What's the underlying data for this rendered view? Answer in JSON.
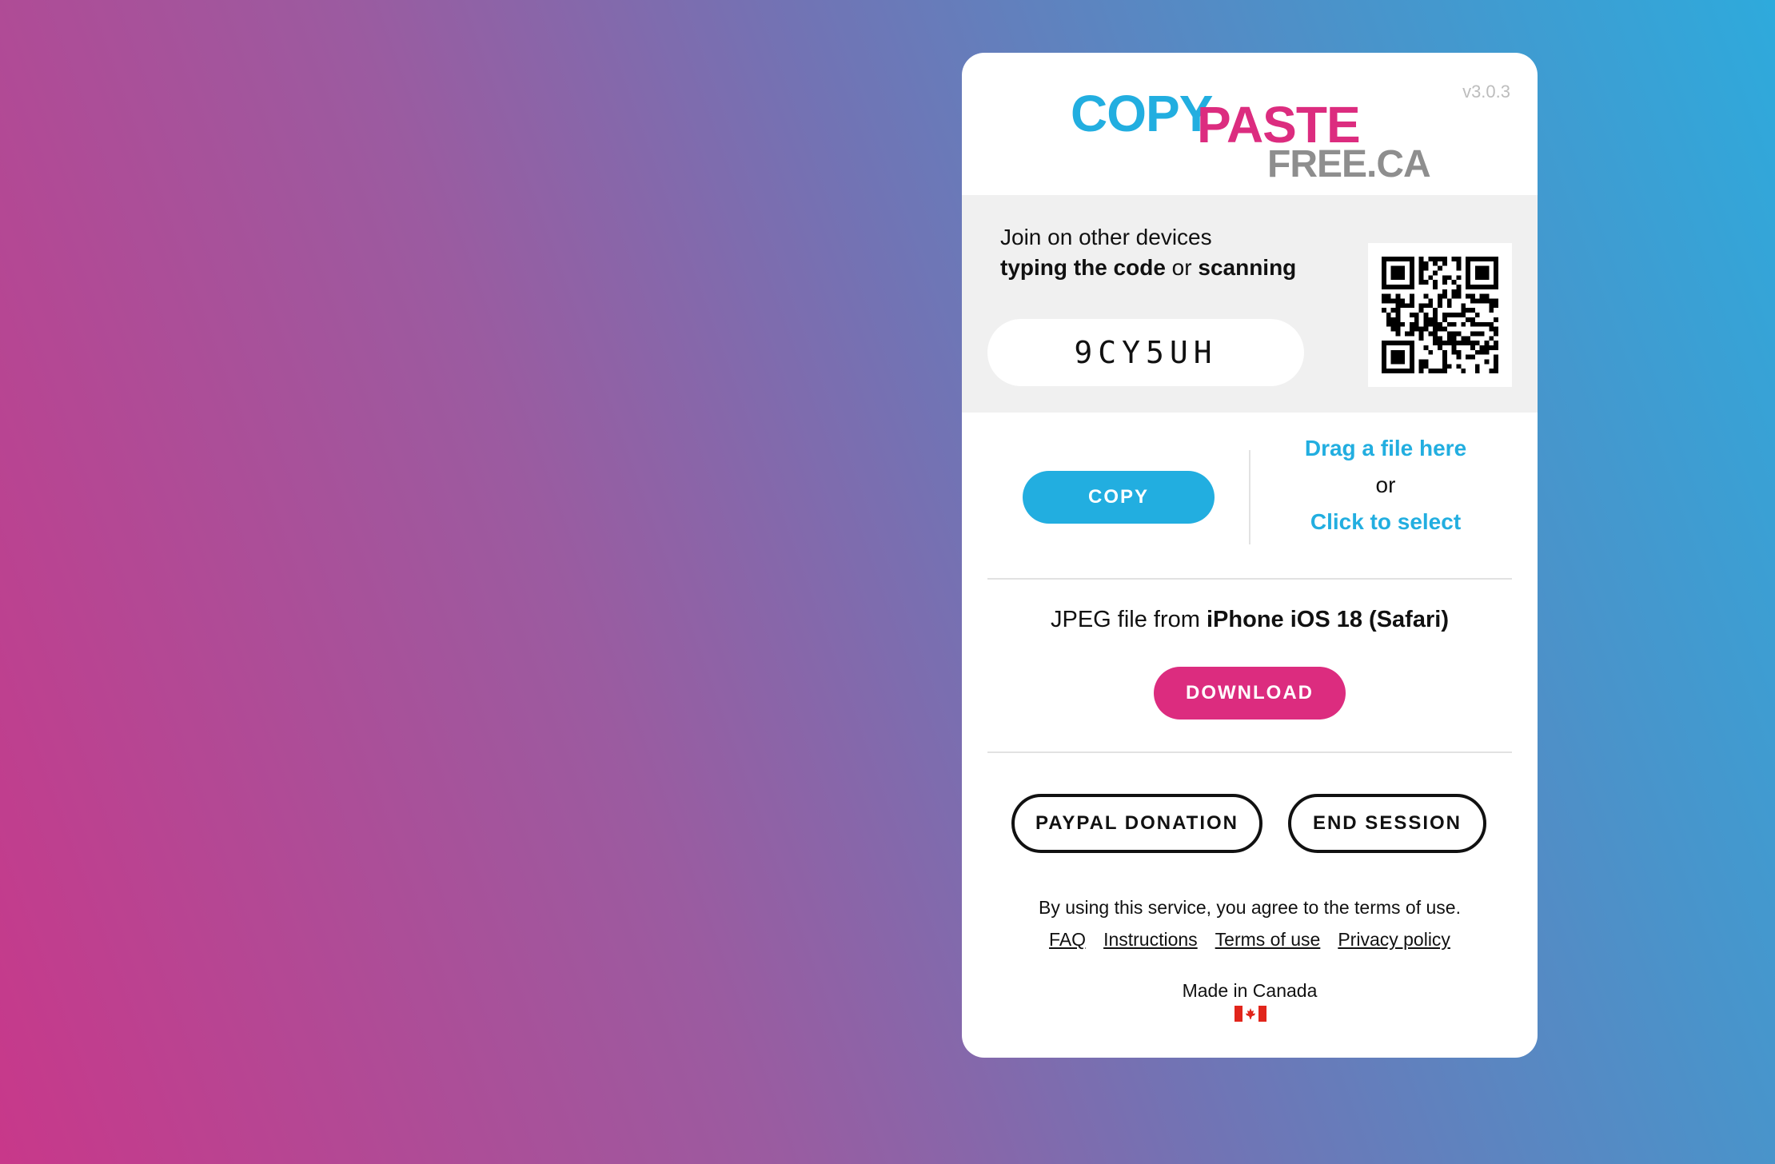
{
  "app": {
    "logo": {
      "copy": "COPY",
      "paste": "PASTE",
      "free": "FREE.CA"
    },
    "version": "v3.0.3"
  },
  "join": {
    "line1": "Join on other devices",
    "line2_bold1": "typing the code",
    "line2_mid": " or ",
    "line2_bold2": "scanning",
    "code": "9CY5UH"
  },
  "actions": {
    "copy_label": "COPY",
    "drag_label": "Drag a file here",
    "or_label": "or",
    "click_label": "Click to select"
  },
  "file": {
    "prefix": "JPEG file from ",
    "source": "iPhone iOS 18 (Safari)",
    "download_label": "DOWNLOAD"
  },
  "buttons": {
    "paypal_label": "PAYPAL DONATION",
    "end_label": "END SESSION"
  },
  "footer": {
    "terms_text": "By using this service, you agree to the terms of use.",
    "links": [
      "FAQ",
      "Instructions",
      "Terms of use",
      "Privacy policy"
    ],
    "made_in": "Made in Canada"
  },
  "colors": {
    "accent_blue": "#22aee0",
    "accent_pink": "#dc2c7f",
    "logo_grey": "#8e8e8e"
  },
  "icons": {
    "qr": "qr-code-icon",
    "flag": "canada-flag-icon"
  }
}
